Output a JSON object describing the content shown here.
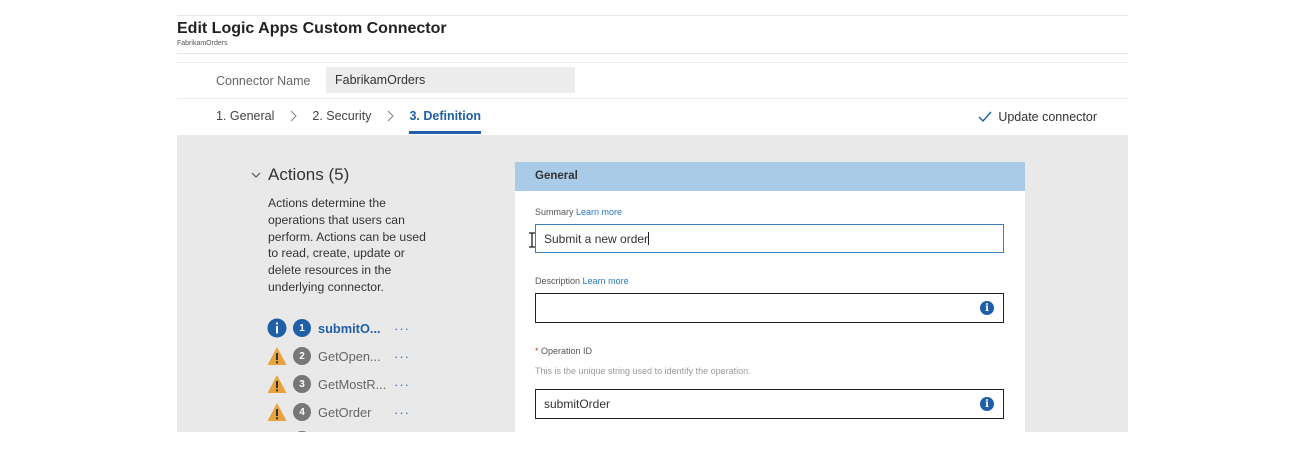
{
  "header": {
    "title": "Edit Logic Apps Custom Connector",
    "subtitle": "FabrikamOrders"
  },
  "connector": {
    "label": "Connector Name",
    "value": "FabrikamOrders"
  },
  "steps": [
    {
      "label": "1. General",
      "active": false
    },
    {
      "label": "2. Security",
      "active": false
    },
    {
      "label": "3. Definition",
      "active": true
    }
  ],
  "update_label": "Update connector",
  "actions": {
    "title": "Actions (5)",
    "description": "Actions determine the operations that users can perform. Actions can be used to read, create, update or delete resources in the underlying connector.",
    "items": [
      {
        "num": "1",
        "name": "submitO...",
        "status": "info-icon",
        "selected": true,
        "more": "···"
      },
      {
        "num": "2",
        "name": "GetOpen...",
        "status": "warning-icon",
        "selected": false,
        "more": "···"
      },
      {
        "num": "3",
        "name": "GetMostR...",
        "status": "warning-icon",
        "selected": false,
        "more": "···"
      },
      {
        "num": "4",
        "name": "GetOrder",
        "status": "warning-icon",
        "selected": false,
        "more": "···"
      }
    ]
  },
  "general": {
    "heading": "General",
    "summary": {
      "label": "Summary",
      "learn_more": "Learn more",
      "value": "Submit a new order"
    },
    "description": {
      "label": "Description",
      "learn_more": "Learn more",
      "value": ""
    },
    "operation_id": {
      "required_mark": "*",
      "label": "Operation ID",
      "hint": "This is the unique string used to identify the operation.",
      "value": "submitOrder"
    },
    "info_glyph": "i"
  },
  "colors": {
    "accent": "#1f5fa8",
    "section_header": "#a9cbe8",
    "panel_bg": "#e9e9e9",
    "warning": "#e8a33d"
  }
}
